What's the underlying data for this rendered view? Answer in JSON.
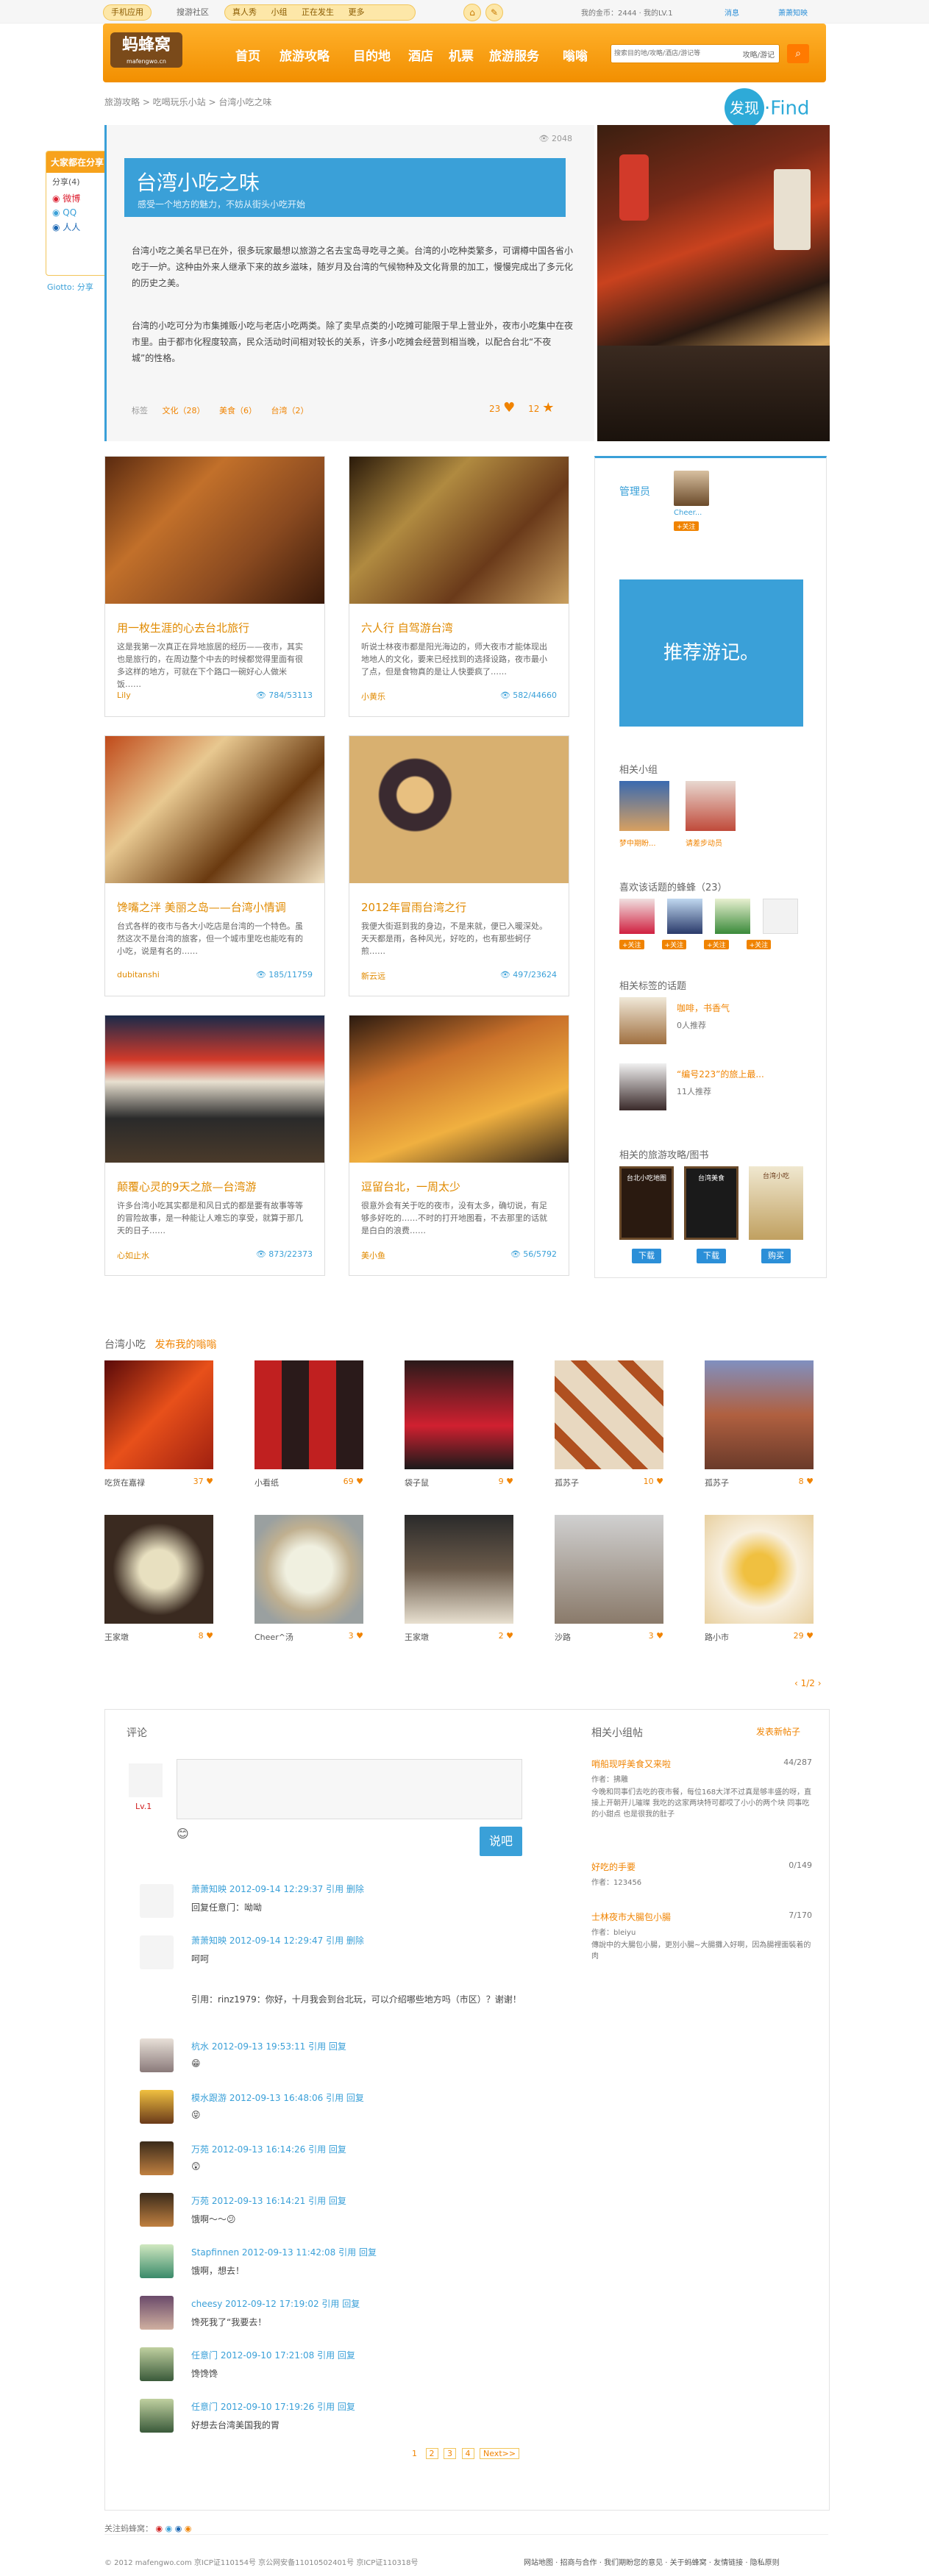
{
  "topbar": {
    "mobile": "手机应用",
    "hot": "搜游社区",
    "links": [
      "真人秀",
      "小组",
      "正在发生",
      "更多"
    ],
    "user": "我的金币：2444 · 我的LV.1",
    "msg": "消息",
    "username": "萧萧知映"
  },
  "header": {
    "logo": "蚂蜂窝",
    "logo_sub": "mafengwo.cn",
    "nav": [
      "首页",
      "旅游攻略",
      "目的地",
      "酒店",
      "机票",
      "旅游服务",
      "嗡嗡"
    ],
    "search_placeholder": "搜索目的地/攻略/酒店/游记等",
    "search_scope": "攻略/游记"
  },
  "breadcrumb": "旅游攻略 > 吃喝玩乐小站 > 台湾小吃之味",
  "find": "发现·Find",
  "share": {
    "title": "大家都在分享",
    "label": "分享(4)",
    "items": [
      "微博",
      "QQ",
      "人人"
    ],
    "user": "Giotto: 分享"
  },
  "hero": {
    "views": "2048",
    "title": "台湾小吃之味",
    "subtitle": "感受一个地方的魅力，不妨从街头小吃开始",
    "p1": "台湾小吃之美名早已在外，很多玩家最想以旅游之名去宝岛寻吃寻之美。台湾的小吃种类繁多，可谓樽中国各省小吃于一炉。这种由外来人继承下来的故乡滋味，随岁月及台湾的气候物种及文化背景的加工，慢慢完成出了多元化的历史之美。",
    "p2": "台湾的小吃可分为市集摊贩小吃与老店小吃两类。除了卖早点类的小吃摊可能限于早上营业外，夜市小吃集中在夜市里。由于都市化程度较高，民众活动时间相对较长的关系，许多小吃摊会经营到相当晚，以配合台北“不夜城”的性格。",
    "tags_label": "标签",
    "tags": [
      "文化（28）",
      "美食（6）",
      "台湾（2）"
    ],
    "likes": "23",
    "favs": "12"
  },
  "cards": [
    {
      "title": "用一枚生涯的心去台北旅行",
      "desc": "这是我第一次真正在异地旅居的经历——夜市，其实也是旅行的，在周边整个中去的时候都觉得里面有很多这样的地方，可就在下个路口一碗好心人做米饭……",
      "user": "Lily",
      "stat": "784/53113"
    },
    {
      "title": "六人行 自驾游台湾",
      "desc": "听说士林夜市都是阳光海边的，师大夜市才能体现出地地人的文化，要来已经找到的选择设路，夜市最小了点，但是食物真的是让人快要疯了……",
      "user": "小黄乐",
      "stat": "582/44660"
    },
    {
      "title": "馋嘴之泮 美丽之岛——台湾小情调",
      "desc": "台式各样的夜市与各大小吃店是台湾的一个特色。虽然这次不是台湾的旅客，但一个城市里吃也能吃有的小吃，说是有名的……",
      "user": "dubitanshi",
      "stat": "185/11759"
    },
    {
      "title": "2012年冒雨台湾之行",
      "desc": "我便大街逛到我的身边，不是来就，便已入暖深处。天天都是雨，各种风光，好吃的，也有那些蚵仔煎……",
      "user": "新云远",
      "stat": "497/23624"
    },
    {
      "title": "颠覆心灵的9天之旅—台湾游",
      "desc": "许多台湾小吃其实都是和风日式的都是要有故事等等的冒险故事，是一种能让人难忘的享受，就算于那几天的日子……",
      "user": "心如止水",
      "stat": "873/22373"
    },
    {
      "title": "逗留台北，一周太少",
      "desc": "很意外会有关于吃的夜市，没有太多，确切说，有足够多好吃的……不时的打开地图看，不去那里的话就是白白的浪费……",
      "user": "美小鱼",
      "stat": "56/5792"
    }
  ],
  "sidebar": {
    "admin_label": "管理员",
    "admin_name": "Cheer...",
    "admin_badge": "+关注",
    "promo": "推荐游记。",
    "groups_label": "相关小组",
    "groups": [
      "梦中期盼...",
      "请差步动员"
    ],
    "fans_label": "喜欢该话题的蜂蜂（23）",
    "fans_follow": "+关注",
    "topics_label": "相关标签的话题",
    "topics": [
      {
        "title": "咖啡，书香气",
        "count": "0人推荐"
      },
      {
        "title": "“编号223”的旅上最...",
        "count": "11人推荐"
      }
    ],
    "books_label": "相关的旅游攻略/图书",
    "books": [
      "台北小吃地图",
      "台湾美食",
      "台湾小吃"
    ],
    "book_btns": [
      "下载",
      "下载",
      "购买"
    ]
  },
  "photos": {
    "label": "台湾小吃",
    "link": "发布我的嗡嗡",
    "row1": [
      {
        "user": "吃货在嘉禄",
        "n": "37"
      },
      {
        "user": "小看纸",
        "n": "69"
      },
      {
        "user": "袋子鼠",
        "n": "9"
      },
      {
        "user": "孤苏子",
        "n": "10"
      },
      {
        "user": "孤苏子",
        "n": "8"
      }
    ],
    "row2": [
      {
        "user": "王家墩",
        "n": "8"
      },
      {
        "user": "Cheer^汤",
        "n": "3"
      },
      {
        "user": "王家墩",
        "n": "2"
      },
      {
        "user": "沙路",
        "n": "3"
      },
      {
        "user": "路小市",
        "n": "29"
      }
    ],
    "pager": "‹ 1/2 ›"
  },
  "comments": {
    "label": "评论",
    "level": "Lv.1",
    "submit": "说吧",
    "items": [
      {
        "meta": "萧萧知映  2012-09-14 12:29:37  引用  删除",
        "text": "回复任意门：呦呦"
      },
      {
        "meta": "萧萧知映  2012-09-14 12:29:47  引用  删除",
        "text": "呵呵",
        "quote": "引用：rinz1979：你好，十月我会到台北玩，可以介绍哪些地方吗（市区）？谢谢！"
      },
      {
        "meta": "杭水  2012-09-13 19:53:11  引用  回复",
        "text": "😁"
      },
      {
        "meta": "模水跟游  2012-09-13 16:48:06  引用  回复",
        "text": "😝"
      },
      {
        "meta": "万苑  2012-09-13 16:14:26  引用  回复",
        "text": "😲"
      },
      {
        "meta": "万苑  2012-09-13 16:14:21  引用  回复",
        "text": "饿啊～～😕"
      },
      {
        "meta": "Stapfinnen  2012-09-13 11:42:08  引用  回复",
        "text": "饿啊，想去！"
      },
      {
        "meta": "cheesy  2012-09-12 17:19:02  引用  回复",
        "text": "馋死我了“我要去！"
      },
      {
        "meta": "任意门  2012-09-10 17:21:08  引用  回复",
        "text": "馋馋馋"
      },
      {
        "meta": "任意门  2012-09-10 17:19:26  引用  回复",
        "text": "好想去台湾美国我的胃"
      }
    ],
    "pages": [
      "1",
      "2",
      "3",
      "4",
      "Next>>"
    ]
  },
  "related": {
    "label": "相关小组帖",
    "more": "发表新帖子",
    "posts": [
      {
        "title": "哨船现呼美食又来啦",
        "count": "44/287",
        "author": "作者：拂雕",
        "desc": "今晚和同事们去吃的夜市餐，每位168大洋不过真是够丰盛的呀，直接上开朝开儿璀璨 我吃的这家两块特可都哎了小小的两个块 同事吃的小甜点 也是很我的肚子"
      },
      {
        "title": "好吃的手要",
        "count": "0/149",
        "author": "作者：123456",
        "desc": ""
      },
      {
        "title": "士林夜市大腸包小腸",
        "count": "7/170",
        "author": "作者：bleiyu",
        "desc": "傳說中的大腸包小腸，更別小腸~大腸攤入好啊，因為腸裡面裝着的肉"
      }
    ]
  },
  "footer": {
    "follow": "关注蚂蜂窝：",
    "copy": "© 2012 mafengwo.com 京ICP证110154号 京公网安备11010502401号 京ICP证110318号",
    "links": "网站地图 · 招商与合作 · 我们期盼您的意见 · 关于蚂蜂窝 · 友情链接 · 隐私原则"
  },
  "colors": {
    "orange": "#f08300",
    "blue": "#3aa0d8",
    "header": "#ffa51c"
  }
}
